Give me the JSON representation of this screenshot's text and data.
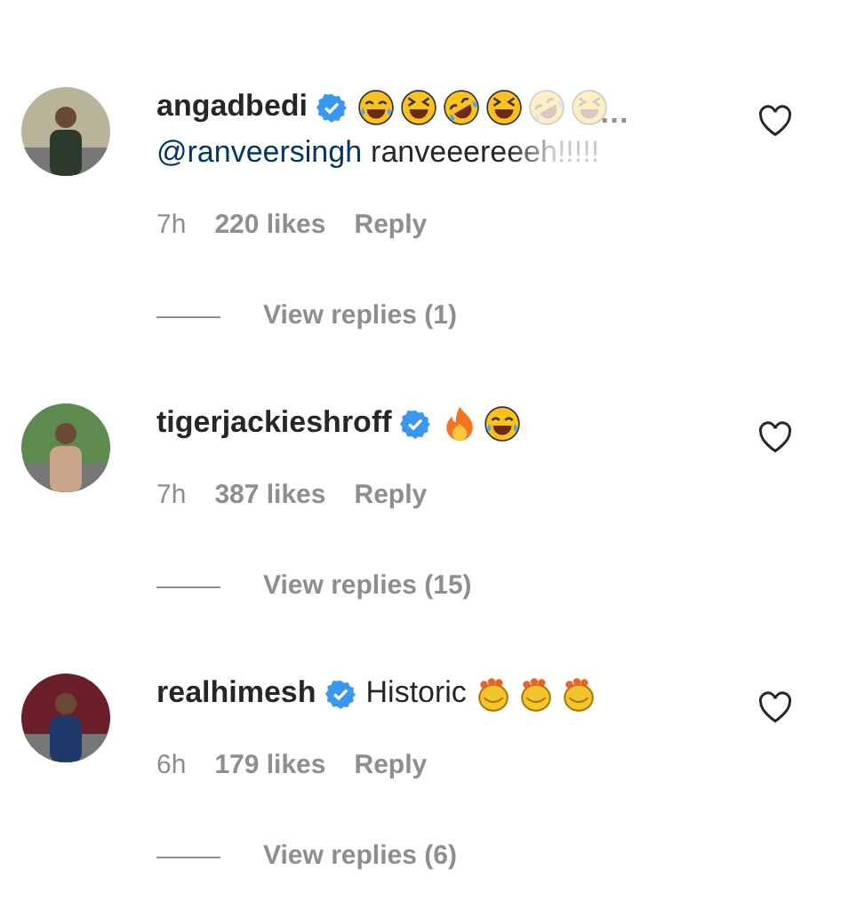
{
  "comments": [
    {
      "username": "angadbedi",
      "verified": true,
      "liked": false,
      "emojis": [
        {
          "kind": "joy",
          "faded": false
        },
        {
          "kind": "squint",
          "faded": false
        },
        {
          "kind": "rofl",
          "faded": false
        },
        {
          "kind": "squint",
          "faded": false
        },
        {
          "kind": "rofl",
          "faded": true
        },
        {
          "kind": "squint",
          "faded": true
        }
      ],
      "more": "…",
      "mention": "@ranveersingh",
      "second_line": "ranveeereeeh!!!!!",
      "time": "7h",
      "likes": "220 likes",
      "reply": "Reply",
      "replies": "View replies (1)"
    },
    {
      "username": "tigerjackieshroff",
      "verified": true,
      "liked": false,
      "emojis": [
        {
          "kind": "fire",
          "faded": false
        },
        {
          "kind": "joy",
          "faded": false
        }
      ],
      "time": "7h",
      "likes": "387 likes",
      "reply": "Reply",
      "replies": "View replies (15)"
    },
    {
      "username": "realhimesh",
      "verified": true,
      "liked": false,
      "text": "Historic",
      "emojis": [
        {
          "kind": "clap",
          "faded": false
        },
        {
          "kind": "clap",
          "faded": false
        },
        {
          "kind": "clap",
          "faded": false
        }
      ],
      "time": "6h",
      "likes": "179 likes",
      "reply": "Reply",
      "replies": "View replies (6)"
    }
  ]
}
